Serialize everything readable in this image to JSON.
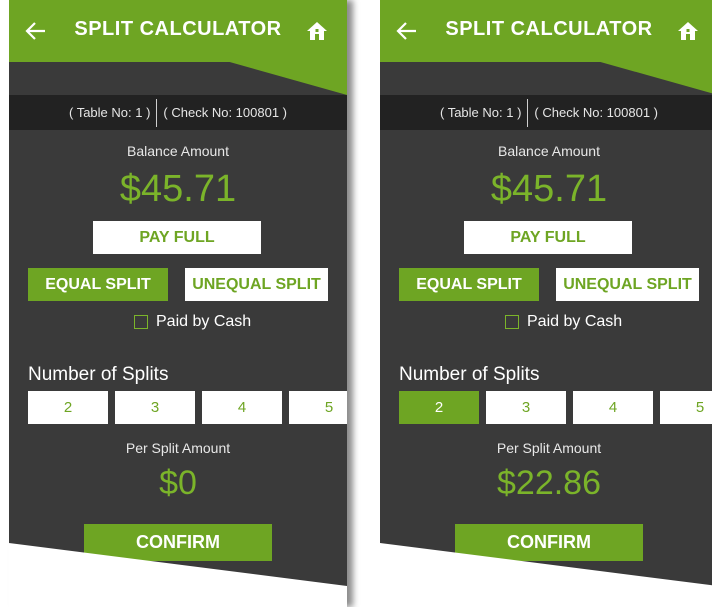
{
  "colors": {
    "brand_green": "#6ea523",
    "amount_green": "#7bb42a",
    "panel_bg": "#3a3a3a",
    "info_bg": "#222222"
  },
  "screens": [
    {
      "title": "SPLIT CALCULATOR",
      "back_icon": "arrow-left-icon",
      "home_icon": "home-icon",
      "table_no": "( Table No: 1 )",
      "check_no": "( Check No: 100801 )",
      "balance_label": "Balance Amount",
      "balance_amount": "$45.71",
      "pay_full": "PAY FULL",
      "equal_split": "EQUAL SPLIT",
      "unequal_split": "UNEQUAL SPLIT",
      "paid_by_cash": "Paid by Cash",
      "paid_by_cash_checked": false,
      "number_of_splits_label": "Number of Splits",
      "split_options": [
        "2",
        "3",
        "4",
        "5"
      ],
      "selected_split": null,
      "per_split_label": "Per Split Amount",
      "per_split_amount": "$0",
      "confirm": "CONFIRM"
    },
    {
      "title": "SPLIT CALCULATOR",
      "back_icon": "arrow-left-icon",
      "home_icon": "home-icon",
      "table_no": "( Table No: 1 )",
      "check_no": "( Check No: 100801 )",
      "balance_label": "Balance Amount",
      "balance_amount": "$45.71",
      "pay_full": "PAY FULL",
      "equal_split": "EQUAL SPLIT",
      "unequal_split": "UNEQUAL SPLIT",
      "paid_by_cash": "Paid by Cash",
      "paid_by_cash_checked": false,
      "number_of_splits_label": "Number of Splits",
      "split_options": [
        "2",
        "3",
        "4",
        "5"
      ],
      "selected_split": "2",
      "per_split_label": "Per Split Amount",
      "per_split_amount": "$22.86",
      "confirm": "CONFIRM"
    }
  ]
}
